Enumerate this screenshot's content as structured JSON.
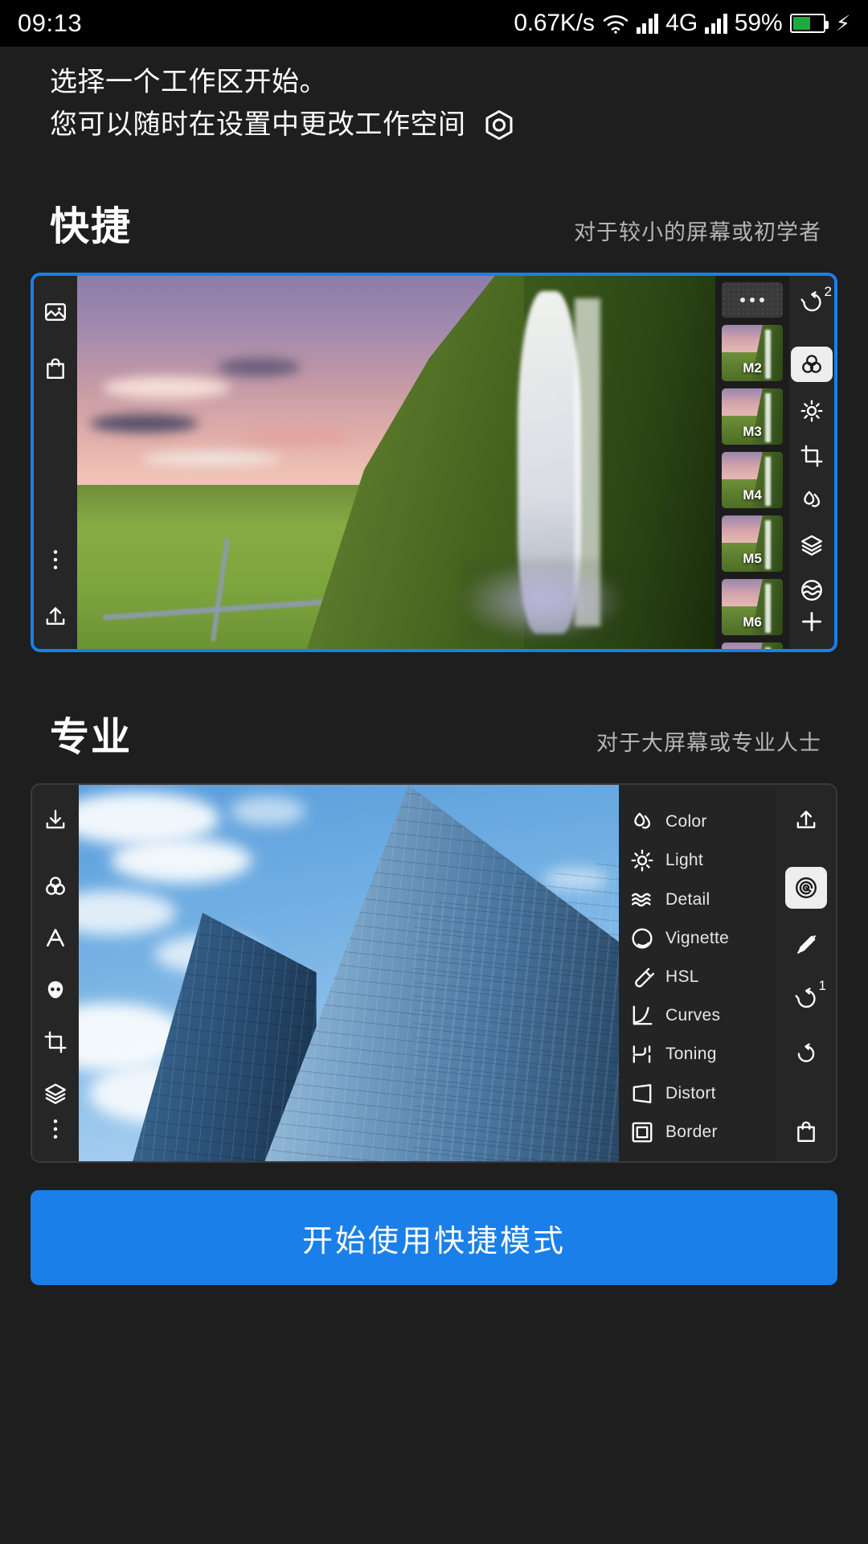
{
  "status_bar": {
    "time": "09:13",
    "net_speed": "0.67K/s",
    "wifi_icon": "wifi-icon",
    "signal_icon": "signal-bars-icon",
    "network_type": "4G",
    "battery_percent": "59%",
    "battery_level": 59,
    "charging_icon": "charging-bolt-icon"
  },
  "header": {
    "line1": "选择一个工作区开始。",
    "line2": "您可以随时在设置中更改工作空间",
    "settings_icon": "hex-nut-settings-icon"
  },
  "sections": [
    {
      "title": "快捷",
      "subtitle": "对于较小的屏幕或初学者",
      "selected": true,
      "left_rail_icons": [
        "image-icon",
        "shopping-bag-icon",
        "more-vertical-icon",
        "export-upload-icon"
      ],
      "preset_more_label": "...",
      "presets": [
        "M2",
        "M3",
        "M4",
        "M5",
        "M6"
      ],
      "right_rail": [
        {
          "icon": "history-undo-icon",
          "badge": "2",
          "active": false
        },
        {
          "icon": "color-wheel-icon",
          "badge": "",
          "active": true
        },
        {
          "icon": "light-sun-icon",
          "badge": "",
          "active": false
        },
        {
          "icon": "crop-icon",
          "badge": "",
          "active": false
        },
        {
          "icon": "water-drops-icon",
          "badge": "",
          "active": false
        },
        {
          "icon": "layers-icon",
          "badge": "",
          "active": false
        },
        {
          "icon": "detail-waves-icon",
          "badge": "",
          "active": false
        },
        {
          "icon": "plus-icon",
          "badge": "",
          "active": false
        }
      ]
    },
    {
      "title": "专业",
      "subtitle": "对于大屏幕或专业人士",
      "selected": false,
      "left_rail_icons": [
        "download-icon",
        "color-wheel-icon",
        "text-icon",
        "portrait-face-icon",
        "crop-icon",
        "layers-icon",
        "more-vertical-icon"
      ],
      "menu_items": [
        {
          "icon": "water-drops-icon",
          "label": "Color"
        },
        {
          "icon": "light-sun-icon",
          "label": "Light"
        },
        {
          "icon": "detail-waves-icon",
          "label": "Detail"
        },
        {
          "icon": "vignette-icon",
          "label": "Vignette"
        },
        {
          "icon": "hsl-icon",
          "label": "HSL"
        },
        {
          "icon": "curves-icon",
          "label": "Curves"
        },
        {
          "icon": "toning-icon",
          "label": "Toning"
        },
        {
          "icon": "distort-icon",
          "label": "Distort"
        },
        {
          "icon": "border-icon",
          "label": "Border"
        }
      ],
      "right_rail": [
        {
          "icon": "export-upload-icon",
          "badge": "",
          "active": false
        },
        {
          "icon": "selective-spiral-icon",
          "badge": "",
          "active": true
        },
        {
          "icon": "retouch-brush-icon",
          "badge": "",
          "active": false
        },
        {
          "icon": "history-undo-icon",
          "badge": "1",
          "active": false
        },
        {
          "icon": "reset-icon",
          "badge": "",
          "active": false
        },
        {
          "icon": "shopping-bag-icon",
          "badge": "",
          "active": false
        }
      ]
    }
  ],
  "cta": {
    "label": "开始使用快捷模式"
  },
  "colors": {
    "background": "#1e1e1e",
    "accent": "#1a7fe8",
    "card": "#262626",
    "text_primary": "#ffffff",
    "text_secondary": "#b5b5b5",
    "battery_green": "#1faa3c"
  }
}
